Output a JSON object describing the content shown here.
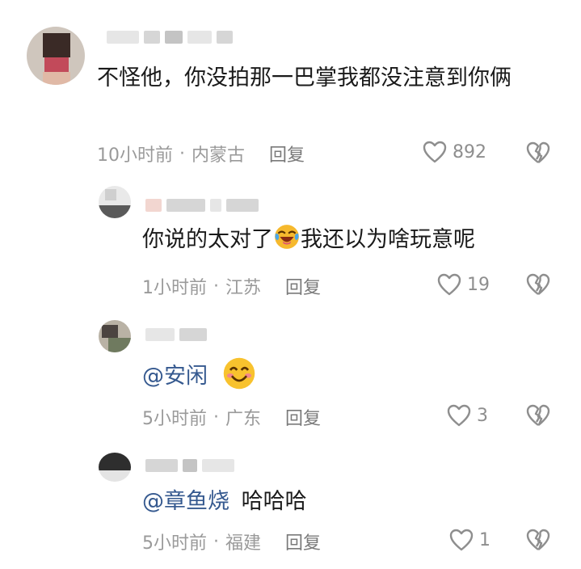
{
  "comments": [
    {
      "text": "不怪他，你没拍那一巴掌我都没注意到你俩",
      "time": "10小时前",
      "location": "内蒙古",
      "reply_label": "回复",
      "likes": "892"
    },
    {
      "text_before": "你说的太对了",
      "text_after": "我还以为啥玩意呢",
      "time": "1小时前",
      "location": "江苏",
      "reply_label": "回复",
      "likes": "19"
    },
    {
      "mention": "@安闲",
      "time": "5小时前",
      "location": "广东",
      "reply_label": "回复",
      "likes": "3"
    },
    {
      "mention": "@章鱼烧",
      "text": "哈哈哈",
      "time": "5小时前",
      "location": "福建",
      "reply_label": "回复",
      "likes": "1"
    }
  ],
  "meta_separator": "·",
  "icons": {
    "like": "heart-outline-icon",
    "dislike": "broken-heart-icon",
    "emoji_laugh": "face-with-tears-of-joy-emoji",
    "emoji_smile": "smiling-face-emoji"
  },
  "colors": {
    "mention": "#35598f",
    "meta": "#9a9a9a",
    "text": "#1a1a1a"
  }
}
